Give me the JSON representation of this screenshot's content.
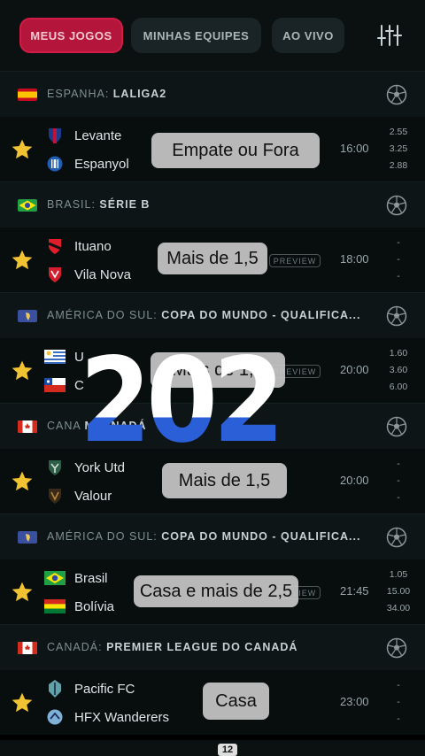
{
  "header": {
    "tabs": [
      {
        "label": "MEUS JOGOS",
        "active": true
      },
      {
        "label": "MINHAS EQUIPES",
        "active": false
      },
      {
        "label": "AO VIVO",
        "active": false
      }
    ]
  },
  "sections": [
    {
      "country": "ESPANHA:",
      "competition": "LALIGA2",
      "flag": "spain",
      "match": {
        "home": "Levante",
        "away": "Espanyol",
        "time": "16:00",
        "odds": [
          "2.55",
          "3.25",
          "2.88"
        ],
        "preview": null
      }
    },
    {
      "country": "BRASIL:",
      "competition": "SÉRIE B",
      "flag": "brazil",
      "match": {
        "home": "Ituano",
        "away": "Vila Nova",
        "time": "18:00",
        "odds": [
          "-",
          "-",
          "-"
        ],
        "preview": "PREVIEW"
      }
    },
    {
      "country": "AMÉRICA DO SUL:",
      "competition": "COPA DO MUNDO - QUALIFICA...",
      "flag": "south-america",
      "match": {
        "home": "U",
        "away": "C",
        "time": "20:00",
        "odds": [
          "1.60",
          "3.60",
          "6.00"
        ],
        "preview": "PREVIEW"
      }
    },
    {
      "country": "CANA",
      "competition": "MI        ANADÁ",
      "flag": "canada",
      "match": {
        "home": "York Utd",
        "away": "Valour",
        "time": "20:00",
        "odds": [
          "-",
          "-",
          "-"
        ],
        "preview": null
      }
    },
    {
      "country": "AMÉRICA DO SUL:",
      "competition": "COPA DO MUNDO - QUALIFICA...",
      "flag": "south-america",
      "match": {
        "home": "Brasil",
        "away": "Bolívia",
        "time": "21:45",
        "odds": [
          "1.05",
          "15.00",
          "34.00"
        ],
        "preview": "PREVIEW"
      }
    },
    {
      "country": "CANADÁ:",
      "competition": "PREMIER LEAGUE DO CANADÁ",
      "flag": "canada",
      "match": {
        "home": "Pacific FC",
        "away": "HFX Wanderers",
        "time": "23:00",
        "odds": [
          "-",
          "-",
          "-"
        ],
        "preview": null
      }
    }
  ],
  "overlays": [
    "Empate ou Fora",
    "Mais de 1,5",
    "Mais de 1,5",
    "Mais de 1,5",
    "Casa e mais de 2,5",
    "Casa"
  ],
  "big_number": "202",
  "bottom_nav": {
    "badge": "12"
  },
  "colors": {
    "accent": "#b3163a",
    "star": "#f1c232",
    "background": "#080d0e"
  }
}
